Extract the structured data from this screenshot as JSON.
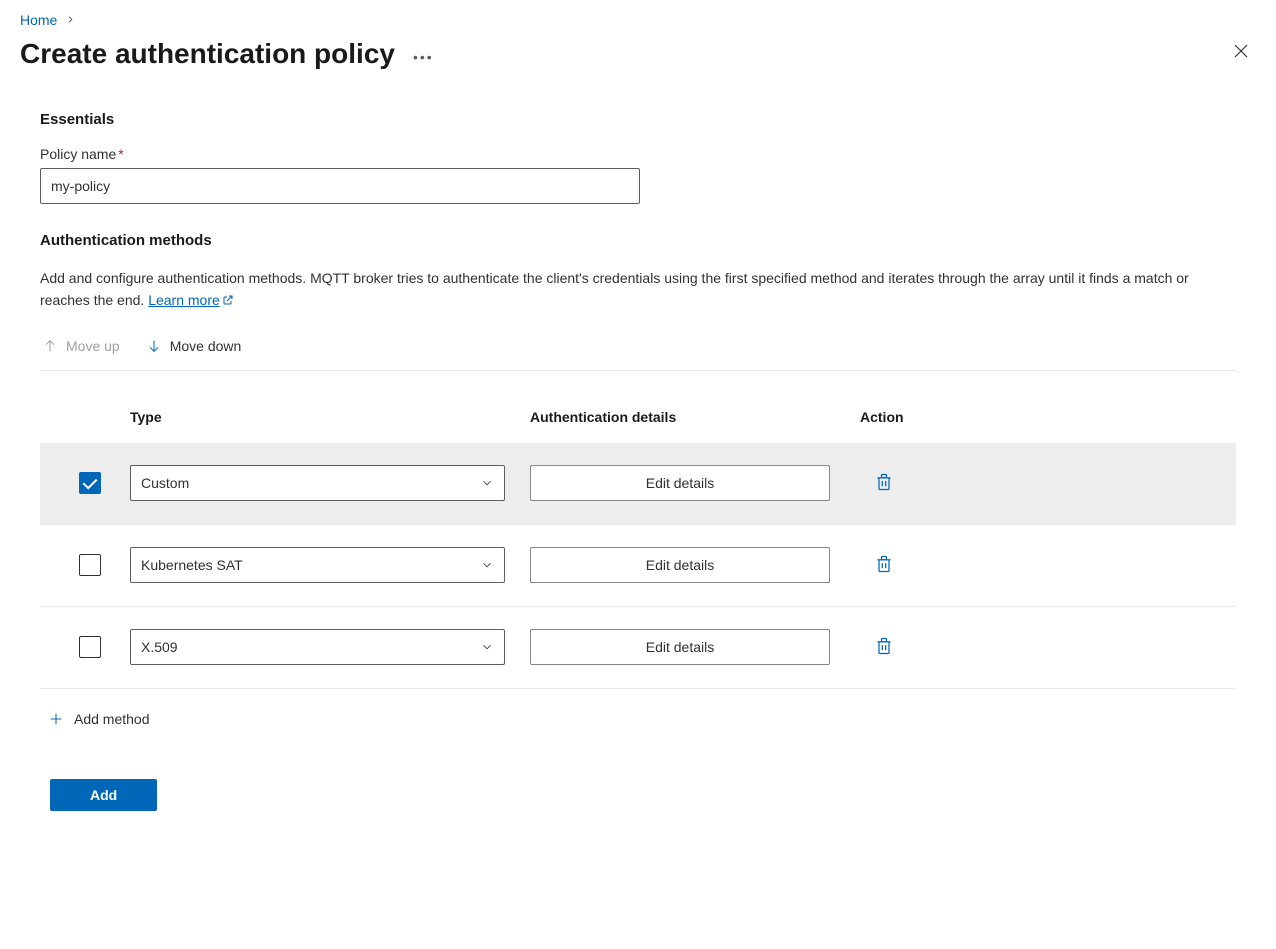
{
  "breadcrumb": {
    "home": "Home"
  },
  "header": {
    "title": "Create authentication policy"
  },
  "essentials": {
    "heading": "Essentials",
    "policy_name_label": "Policy name",
    "policy_name_value": "my-policy"
  },
  "auth": {
    "heading": "Authentication methods",
    "description": "Add and configure authentication methods. MQTT broker tries to authenticate the client's credentials using the first specified method and iterates through the array until it finds a match or reaches the end. ",
    "learn_more": "Learn more"
  },
  "toolbar": {
    "move_up": "Move up",
    "move_down": "Move down"
  },
  "table": {
    "headers": {
      "type": "Type",
      "details": "Authentication details",
      "action": "Action"
    },
    "edit_label": "Edit details",
    "rows": [
      {
        "selected": true,
        "type": "Custom"
      },
      {
        "selected": false,
        "type": "Kubernetes SAT"
      },
      {
        "selected": false,
        "type": "X.509"
      }
    ]
  },
  "add_method_label": "Add method",
  "footer": {
    "add": "Add"
  }
}
